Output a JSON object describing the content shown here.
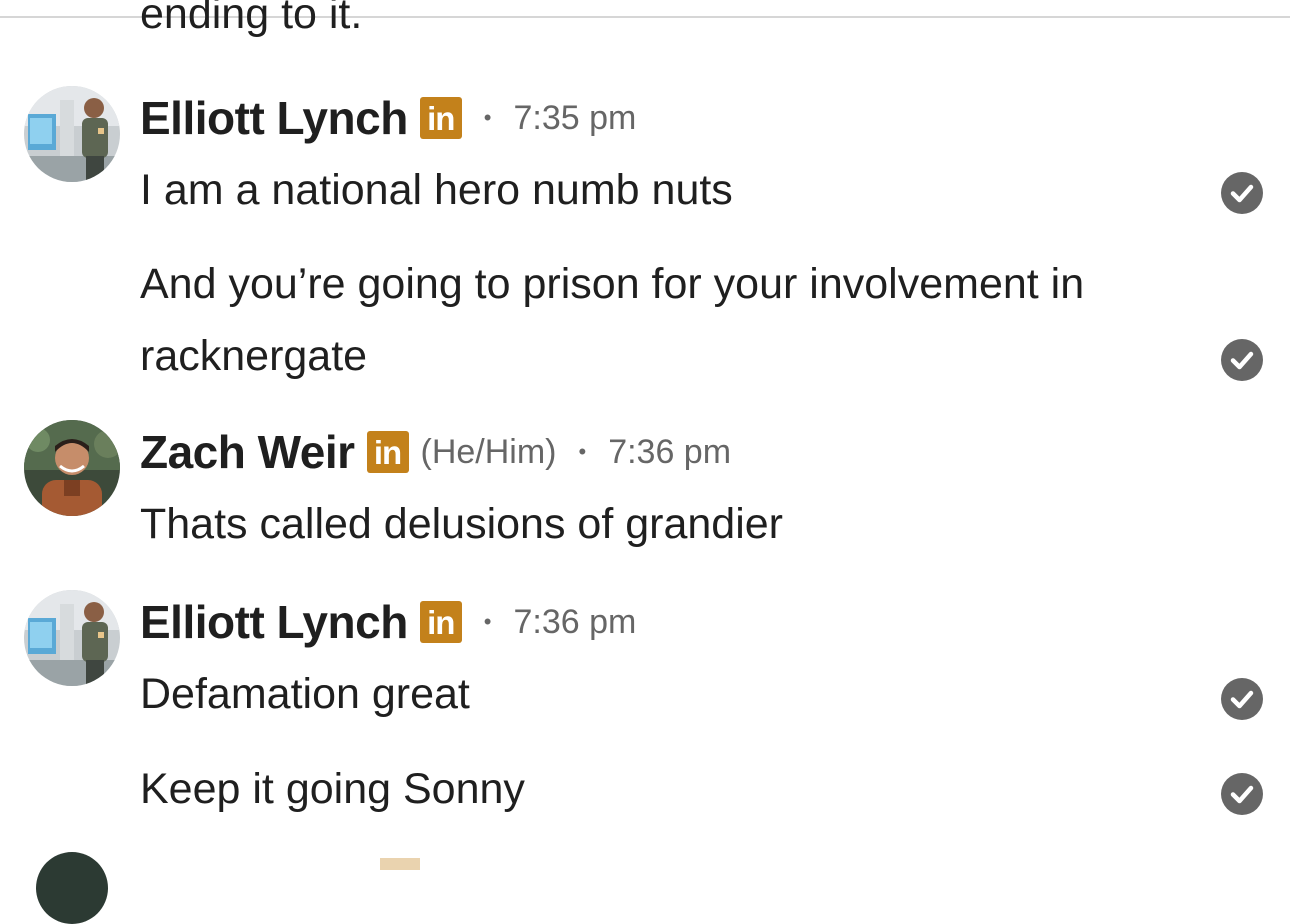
{
  "partial_message": "ending to it.",
  "groups": [
    {
      "sender": "Elliott Lynch",
      "badge": "in",
      "pronouns": "",
      "separator": "•",
      "time": "7:35 pm",
      "messages": [
        {
          "text": "I am a national hero numb nuts"
        },
        {
          "text": "And you’re going to prison for your involvement in racknergate"
        }
      ]
    },
    {
      "sender": "Zach Weir",
      "badge": "in",
      "pronouns": "(He/Him)",
      "separator": "•",
      "time": "7:36 pm",
      "messages": [
        {
          "text": "Thats called delusions of grandier"
        }
      ]
    },
    {
      "sender": "Elliott Lynch",
      "badge": "in",
      "pronouns": "",
      "separator": "•",
      "time": "7:36 pm",
      "messages": [
        {
          "text": "Defamation great"
        },
        {
          "text": "Keep it going Sonny"
        }
      ]
    }
  ],
  "icons": {
    "read_receipt": "check-circle-icon",
    "badge": "linkedin-icon"
  },
  "colors": {
    "badge": "#c3811b",
    "meta_text": "#666666",
    "read_receipt": "#666666"
  }
}
